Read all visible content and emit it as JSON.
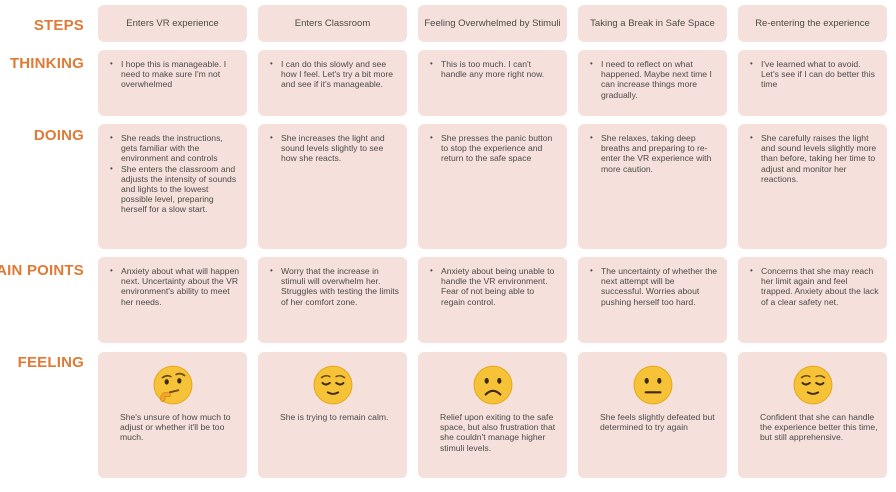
{
  "row_labels": {
    "steps": "STEPS",
    "thinking": "THINKING",
    "doing": "DOING",
    "pain_points": "PAIN POINTS",
    "feeling": "FEELING"
  },
  "steps": [
    "Enters VR experience",
    "Enters Classroom",
    "Feeling Overwhelmed by Stimuli",
    "Taking a Break in Safe Space",
    "Re-entering the experience"
  ],
  "thinking": [
    "I hope this is manageable. I need to make sure I'm not overwhelmed",
    "I can do this slowly and see how I feel. Let's try a bit more and see if it's manageable.",
    "This is too much. I can't handle any more right now.",
    "I need to reflect on what happened. Maybe next time I can increase things more gradually.",
    "I've learned what to avoid. Let's see if I can do better this time"
  ],
  "doing": [
    [
      "She reads the instructions, gets familiar with the environment and controls",
      "She enters the classroom and adjusts the intensity of sounds and lights to the lowest possible level, preparing herself for a slow start."
    ],
    [
      "She increases the light and sound levels slightly to see how she reacts."
    ],
    [
      "She presses the panic button to stop the experience and return to the safe space"
    ],
    [
      "She relaxes, taking deep breaths and preparing to re-enter the VR experience with more caution."
    ],
    [
      "She carefully raises the light and sound levels slightly more than before, taking her time to adjust and monitor her reactions."
    ]
  ],
  "pain_points": [
    "Anxiety about what will happen next. Uncertainty about the VR environment's ability to meet her needs.",
    "Worry that the increase in stimuli will overwhelm her. Struggles with testing the limits of her comfort zone.",
    "Anxiety about being unable to handle the VR environment. Fear of not being able to regain control.",
    "The uncertainty of whether the next attempt will be successful. Worries about pushing herself too hard.",
    "Concerns that she may reach her limit again and feel trapped. Anxiety about the lack of a clear safety net."
  ],
  "feeling": [
    {
      "icon": "thinking-face-icon",
      "text": "She's unsure of how much to adjust or whether it'll be too much."
    },
    {
      "icon": "relieved-face-icon",
      "text": "She is trying to remain calm."
    },
    {
      "icon": "frowning-face-icon",
      "text": "Relief upon exiting to the safe space, but also frustration that she couldn't manage higher stimuli levels."
    },
    {
      "icon": "neutral-face-icon",
      "text": "She feels slightly defeated but determined to try again"
    },
    {
      "icon": "relieved-face-icon",
      "text": "Confident that she can handle the experience better this time, but still apprehensive."
    }
  ],
  "colors": {
    "label": "#e07a36",
    "card": "#f6e0db",
    "text": "#4a4a4a",
    "emoji_face": "#f6c338"
  }
}
